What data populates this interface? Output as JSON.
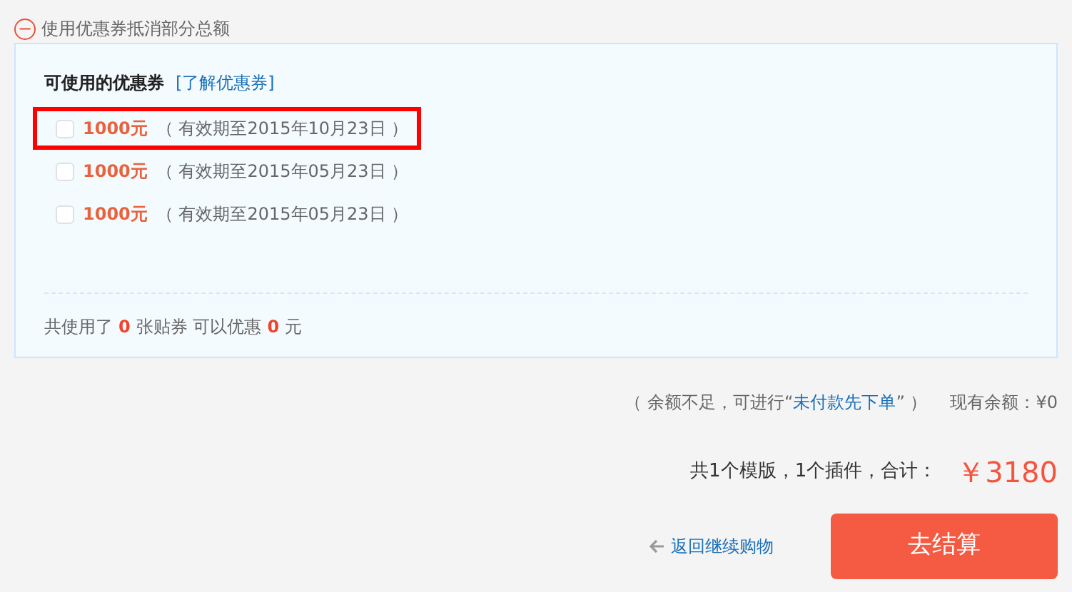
{
  "toggle": {
    "icon": "−",
    "label": "使用优惠券抵消部分总额",
    "expanded": true
  },
  "coupons_panel": {
    "title": "可使用的优惠券",
    "help_link": "[了解优惠券]",
    "coupons": [
      {
        "amount": "1000元",
        "validity": "（ 有效期至2015年10月23日 ）",
        "checked": false,
        "highlighted": true
      },
      {
        "amount": "1000元",
        "validity": "（ 有效期至2015年05月23日 ）",
        "checked": false,
        "highlighted": false
      },
      {
        "amount": "1000元",
        "validity": "（ 有效期至2015年05月23日 ）",
        "checked": false,
        "highlighted": false
      }
    ],
    "summary": [
      "共使用了",
      "0",
      "张贴券 可以优惠",
      "0",
      "元"
    ]
  },
  "balance": {
    "note_before": "（ 余额不足，可进行“",
    "link": "未付款先下单",
    "note_after": "” ）",
    "label": "现有余额：¥0"
  },
  "total": {
    "label": "共1个模版，1个插件，合计：",
    "amount": "￥3180"
  },
  "back_link": "返回继续购物",
  "checkout_button": "去结算"
}
